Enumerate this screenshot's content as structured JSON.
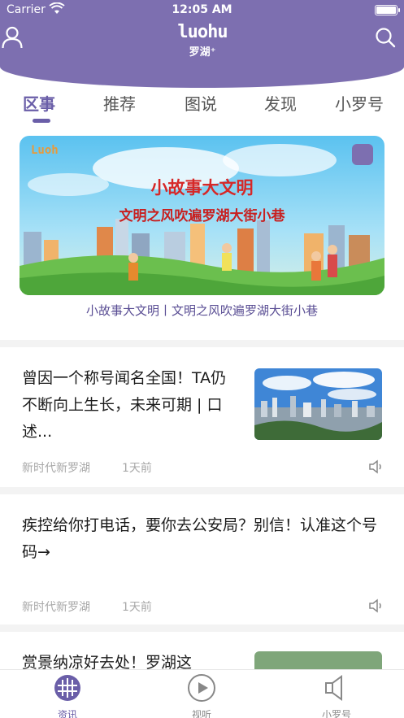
{
  "status": {
    "carrier": "Carrier",
    "time": "12:05 AM"
  },
  "header": {
    "logo_text": "luohu",
    "logo_sub": "罗湖⁺"
  },
  "tabs": [
    "区事",
    "推荐",
    "图说",
    "发现",
    "小罗号"
  ],
  "banner": {
    "logo": "Luoh",
    "title": "小故事大文明",
    "subtitle": "文明之风吹遍罗湖大街小巷",
    "caption": "小故事大文明丨文明之风吹遍罗湖大街小巷"
  },
  "articles": [
    {
      "title": "曾因一个称号闻名全国！TA仍不断向上生长，未来可期 | 口述...",
      "source": "新时代新罗湖",
      "time": "1天前"
    },
    {
      "title": "疾控给你打电话，要你去公安局？别信！认准这个号码→",
      "source": "新时代新罗湖",
      "time": "1天前"
    },
    {
      "title": "赏景纳凉好去处！罗湖这"
    }
  ],
  "tabbar": [
    {
      "label": "资讯",
      "icon": "globe-icon"
    },
    {
      "label": "视听",
      "icon": "play-icon"
    },
    {
      "label": "小罗号",
      "icon": "speaker-icon"
    }
  ],
  "colors": {
    "brand": "#7d6fb0",
    "accent": "#6a5ea8"
  }
}
